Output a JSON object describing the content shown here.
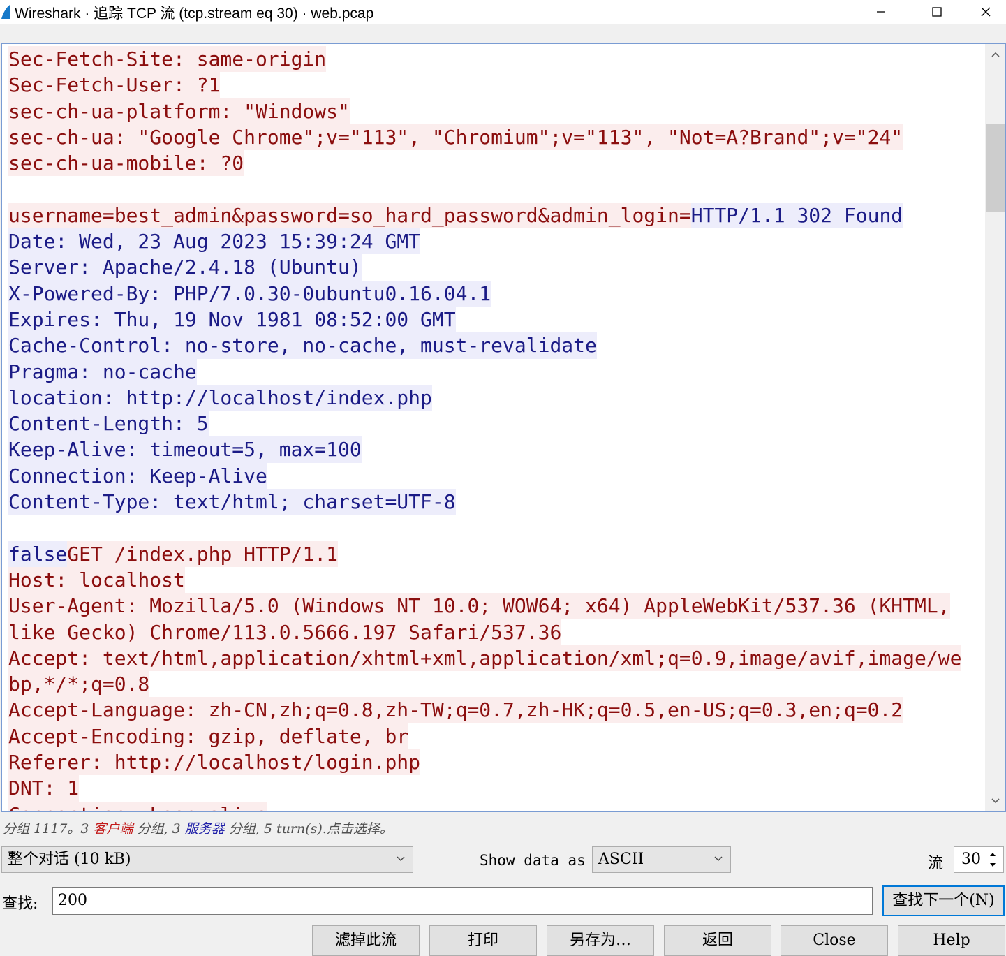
{
  "window": {
    "title": "Wireshark · 追踪 TCP 流 (tcp.stream eq 30) · web.pcap"
  },
  "stream": {
    "lines": [
      [
        {
          "t": "Sec-Fetch-Site: same-origin",
          "k": "c"
        }
      ],
      [
        {
          "t": "Sec-Fetch-User: ?1",
          "k": "c"
        }
      ],
      [
        {
          "t": "sec-ch-ua-platform: \"Windows\"",
          "k": "c"
        }
      ],
      [
        {
          "t": "sec-ch-ua: \"Google Chrome\";v=\"113\", \"Chromium\";v=\"113\", \"Not=A?Brand\";v=\"24\"",
          "k": "c"
        }
      ],
      [
        {
          "t": "sec-ch-ua-mobile: ?0",
          "k": "c"
        }
      ],
      [],
      [
        {
          "t": "username=best_admin&password=so_hard_password&admin_login=",
          "k": "c"
        },
        {
          "t": "HTTP/1.1 302 Found",
          "k": "s"
        }
      ],
      [
        {
          "t": "Date: Wed, 23 Aug 2023 15:39:24 GMT",
          "k": "s"
        }
      ],
      [
        {
          "t": "Server: Apache/2.4.18 (Ubuntu)",
          "k": "s"
        }
      ],
      [
        {
          "t": "X-Powered-By: PHP/7.0.30-0ubuntu0.16.04.1",
          "k": "s"
        }
      ],
      [
        {
          "t": "Expires: Thu, 19 Nov 1981 08:52:00 GMT",
          "k": "s"
        }
      ],
      [
        {
          "t": "Cache-Control: no-store, no-cache, must-revalidate",
          "k": "s"
        }
      ],
      [
        {
          "t": "Pragma: no-cache",
          "k": "s"
        }
      ],
      [
        {
          "t": "location: http://localhost/index.php",
          "k": "s"
        }
      ],
      [
        {
          "t": "Content-Length: 5",
          "k": "s"
        }
      ],
      [
        {
          "t": "Keep-Alive: timeout=5, max=100",
          "k": "s"
        }
      ],
      [
        {
          "t": "Connection: Keep-Alive",
          "k": "s"
        }
      ],
      [
        {
          "t": "Content-Type: text/html; charset=UTF-8",
          "k": "s"
        }
      ],
      [],
      [
        {
          "t": "false",
          "k": "s"
        },
        {
          "t": "GET /index.php HTTP/1.1",
          "k": "c"
        }
      ],
      [
        {
          "t": "Host: localhost",
          "k": "c"
        }
      ],
      [
        {
          "t": "User-Agent: Mozilla/5.0 (Windows NT 10.0; WOW64; x64) AppleWebKit/537.36 (KHTML,",
          "k": "c"
        }
      ],
      [
        {
          "t": "like Gecko) Chrome/113.0.5666.197 Safari/537.36",
          "k": "c"
        }
      ],
      [
        {
          "t": "Accept: text/html,application/xhtml+xml,application/xml;q=0.9,image/avif,image/we",
          "k": "c"
        }
      ],
      [
        {
          "t": "bp,*/*;q=0.8",
          "k": "c"
        }
      ],
      [
        {
          "t": "Accept-Language: zh-CN,zh;q=0.8,zh-TW;q=0.7,zh-HK;q=0.5,en-US;q=0.3,en;q=0.2",
          "k": "c"
        }
      ],
      [
        {
          "t": "Accept-Encoding: gzip, deflate, br",
          "k": "c"
        }
      ],
      [
        {
          "t": "Referer: http://localhost/login.php",
          "k": "c"
        }
      ],
      [
        {
          "t": "DNT: 1",
          "k": "c"
        }
      ],
      [
        {
          "t": "Connection: keep-alive",
          "k": "c"
        }
      ]
    ]
  },
  "status": {
    "prefix": "分组 1117。3 ",
    "client_label": "客户端",
    "middle": " 分组, 3 ",
    "server_label": "服务器",
    "suffix": " 分组, 5 turn(s).点击选择。"
  },
  "controls": {
    "conversation_select": "整个对话 (10 kB)",
    "show_data_as_label": "Show data as",
    "show_data_as_value": "ASCII",
    "stream_label": "流",
    "stream_value": "30",
    "find_label": "查找:",
    "find_value": "200",
    "find_next_button": "查找下一个(N)"
  },
  "buttons": {
    "filter_out": "滤掉此流",
    "print": "打印",
    "save_as": "另存为…",
    "back": "返回",
    "close": "Close",
    "help": "Help"
  },
  "colors": {
    "client_text": "#8b0e0e",
    "client_bg": "#fbeded",
    "server_text": "#1b1b86",
    "server_bg": "#ededfb",
    "accent": "#0078d7"
  }
}
